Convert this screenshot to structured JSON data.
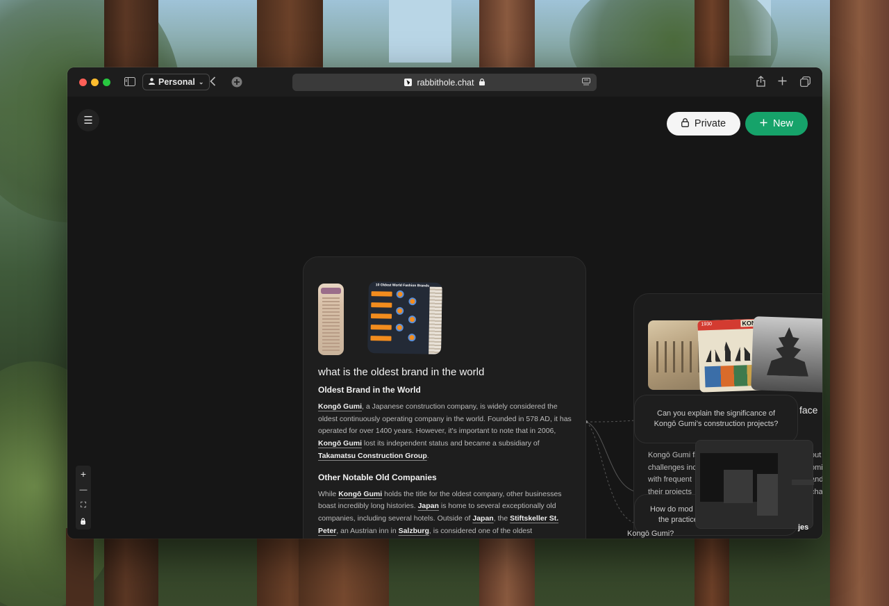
{
  "browser": {
    "profile": "Personal",
    "url": "rabbithole.chat"
  },
  "app": {
    "private_label": "Private",
    "new_label": "New",
    "zoom": {
      "in": "+",
      "out": "—",
      "fit": "⛶",
      "lock": "🔒"
    }
  },
  "main_card": {
    "image2_title": "10 Oldest World Fashion Brands",
    "query": "what is the oldest brand in the world",
    "section1_title": "Oldest Brand in the World",
    "p1": [
      {
        "t": "Kongō Gumi",
        "link": true
      },
      {
        "t": ", a Japanese construction company, is widely considered the oldest continuously operating company in the world. Founded in 578 AD, it has operated for over 1400 years. However, it's important to note that in 2006, "
      },
      {
        "t": "Kongō Gumi",
        "link": true
      },
      {
        "t": " lost its independent status and became a subsidiary of "
      },
      {
        "t": "Takamatsu Construction Group",
        "link": true
      },
      {
        "t": "."
      }
    ],
    "section2_title": "Other Notable Old Companies",
    "p2": [
      {
        "t": "While "
      },
      {
        "t": "Kongō Gumi",
        "link": true
      },
      {
        "t": " holds the title for the oldest company, other businesses boast incredibly long histories. "
      },
      {
        "t": "Japan",
        "link": true
      },
      {
        "t": " is home to several exceptionally old companies, including several hotels. Outside of "
      },
      {
        "t": "Japan",
        "link": true
      },
      {
        "t": ", the "
      },
      {
        "t": "Stiftskeller St. Peter",
        "link": true
      },
      {
        "t": ", an Austrian inn in "
      },
      {
        "t": "Salzburg",
        "link": true
      },
      {
        "t": ", is considered one of the oldest"
      }
    ]
  },
  "right_card": {
    "poster_year": "1930",
    "poster_title": "KON",
    "face_fragment": "face",
    "question1": "Can you explain the significance of Kongō Gumi's construction projects?",
    "body_lines": [
      "Kongō Gumi fa",
      "challenges inc",
      "with frequent",
      "their projects"
    ],
    "edge_lines": [
      "out",
      "omi",
      "and",
      "cha"
    ],
    "question2_lines": [
      "How do mod",
      "the practice"
    ],
    "question2_tail": "Kongō Gumi?",
    "edge_bottom": "jes"
  }
}
